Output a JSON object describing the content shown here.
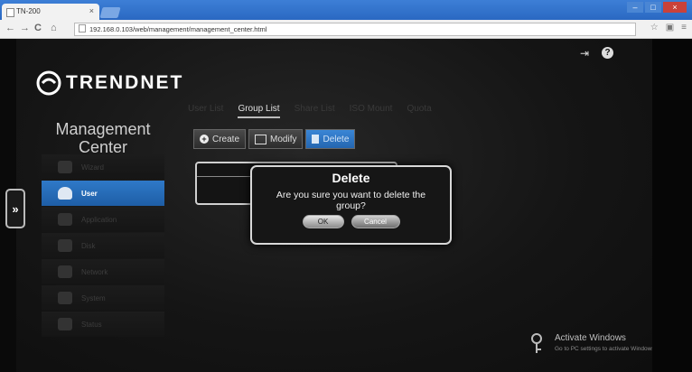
{
  "browser": {
    "tab_title": "TN-200",
    "tab_close": "×",
    "url": "192.168.0.103/web/management/management_center.html",
    "nav": {
      "back": "←",
      "forward": "→",
      "reload": "C",
      "home": "⌂"
    },
    "window_controls": {
      "minimize": "–",
      "maximize": "□",
      "close": "×"
    }
  },
  "app": {
    "logo_text": "TRENDNET",
    "title_line1": "Management",
    "title_line2": "Center",
    "expand_label": "»",
    "menu": [
      {
        "label": "Wizard",
        "icon": "wizard-icon",
        "active": false
      },
      {
        "label": "User",
        "icon": "user-icon",
        "active": true
      },
      {
        "label": "Application",
        "icon": "application-icon",
        "active": false
      },
      {
        "label": "Disk",
        "icon": "disk-icon",
        "active": false
      },
      {
        "label": "Network",
        "icon": "network-icon",
        "active": false
      },
      {
        "label": "System",
        "icon": "system-icon",
        "active": false
      },
      {
        "label": "Status",
        "icon": "status-icon",
        "active": false
      }
    ],
    "tabs": [
      "User List",
      "Group List",
      "Share List",
      "ISO Mount",
      "Quota"
    ],
    "active_tab": "Group List",
    "buttons": {
      "create": "Create",
      "modify": "Modify",
      "delete": "Delete"
    },
    "list_header": "Group"
  },
  "dialog": {
    "title": "Delete",
    "message_line1": "Are you sure you want to delete the",
    "message_line2": "group?",
    "ok": "OK",
    "cancel": "Cancel"
  },
  "watermark": {
    "line1": "Activate Windows",
    "line2": "Go to PC settings to activate Windows."
  },
  "colors": {
    "accent": "#2f79c8",
    "chrome_tab": "#3d7fd6",
    "close_red": "#c9413a"
  }
}
